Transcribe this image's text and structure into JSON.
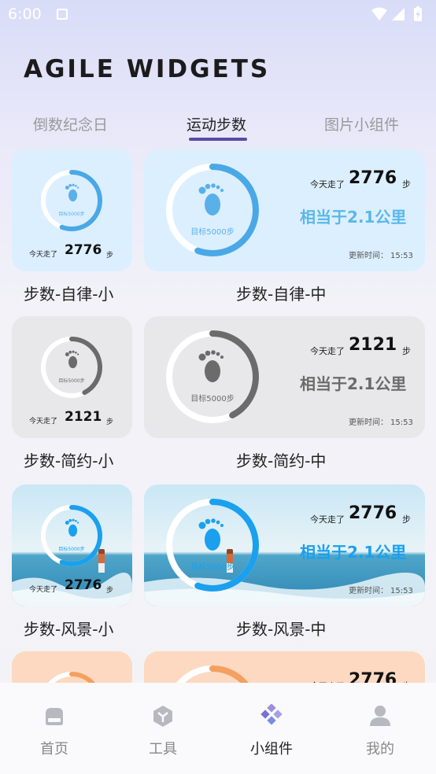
{
  "status_bar": {
    "time": "6:00",
    "icons": [
      "a-icon",
      "wifi-icon",
      "signal-icon",
      "battery-icon"
    ]
  },
  "app": {
    "title": "AGILE WIDGETS"
  },
  "tabs": [
    {
      "label": "倒数纪念日",
      "active": false
    },
    {
      "label": "运动步数",
      "active": true
    },
    {
      "label": "图片小组件",
      "active": false
    }
  ],
  "widgets": {
    "today_label": "今天走了",
    "unit": "步",
    "target": "目标5000步",
    "equiv": "相当于2.1公里",
    "update_prefix": "更新时间：",
    "update_time": "15:53",
    "rows": [
      {
        "small_label": "步数-自律-小",
        "medium_label": "步数-自律-中",
        "steps": "2776",
        "progress": 0.555,
        "theme": "light-blue"
      },
      {
        "small_label": "步数-简约-小",
        "medium_label": "步数-简约-中",
        "steps": "2121",
        "progress": 0.424,
        "theme": "gray"
      },
      {
        "small_label": "步数-风景-小",
        "medium_label": "步数-风景-中",
        "steps": "2776",
        "progress": 0.555,
        "theme": "scenery"
      },
      {
        "small_label": "",
        "medium_label": "",
        "steps": "2776",
        "progress": 0.555,
        "theme": "orange"
      }
    ]
  },
  "colors": {
    "accent": "#5a4aa6",
    "blue": "#4aa8e6",
    "gray": "#6b6b6b",
    "orange": "#f4a060"
  },
  "bottom_nav": [
    {
      "label": "首页",
      "icon": "home-icon",
      "active": false
    },
    {
      "label": "工具",
      "icon": "cube-icon",
      "active": false
    },
    {
      "label": "小组件",
      "icon": "widgets-icon",
      "active": true
    },
    {
      "label": "我的",
      "icon": "profile-icon",
      "active": false
    }
  ]
}
